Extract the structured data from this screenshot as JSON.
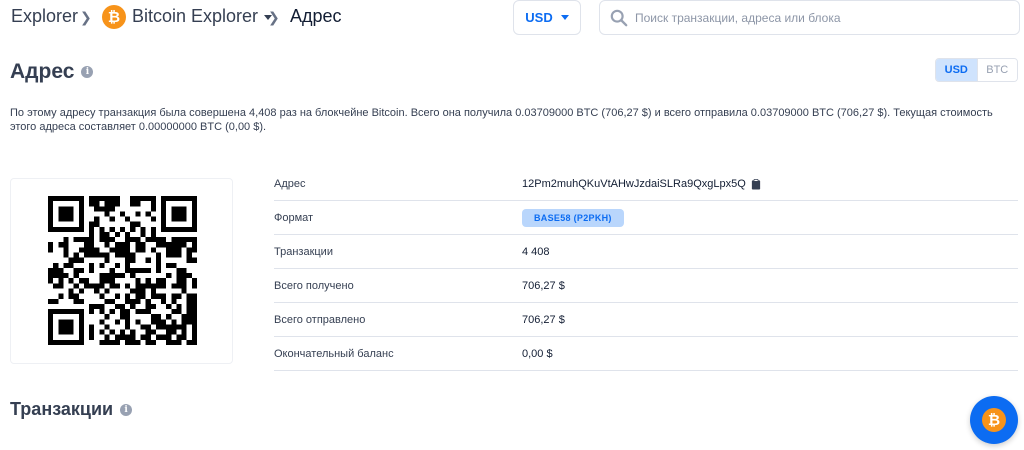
{
  "breadcrumb": {
    "explorer": "Explorer",
    "chain": "Bitcoin Explorer",
    "current": "Адрес"
  },
  "currency_select": {
    "value": "USD"
  },
  "search": {
    "placeholder": "Поиск транзакции, адреса или блока"
  },
  "page": {
    "title": "Адрес",
    "toggle": {
      "usd": "USD",
      "btc": "BTC",
      "active": "USD"
    },
    "summary": "По этому адресу транзакция была совершена 4,408 раз на блокчейне Bitcoin. Всего она получила 0.03709000 BTC (706,27 $) и всего отправила 0.03709000 BTC (706,27 $). Текущая стоимость этого адреса составляет 0.00000000 BTC (0,00 $)."
  },
  "details": [
    {
      "label": "Адрес",
      "value": "12Pm2muhQKuVtAHwJzdaiSLRa9QxgLpx5Q"
    },
    {
      "label": "Формат",
      "value": "BASE58 (P2PKH)"
    },
    {
      "label": "Транзакции",
      "value": "4 408"
    },
    {
      "label": "Всего получено",
      "value": "706,27 $"
    },
    {
      "label": "Всего отправлено",
      "value": "706,27 $"
    },
    {
      "label": "Окончательный баланс",
      "value": "0,00 $"
    }
  ],
  "transactions": {
    "title": "Транзакции"
  },
  "brand": {
    "logo_glyph": "₿",
    "accent": "#0c6cf2",
    "bitcoin_orange": "#f7931a"
  },
  "icons": {
    "info": "i"
  }
}
